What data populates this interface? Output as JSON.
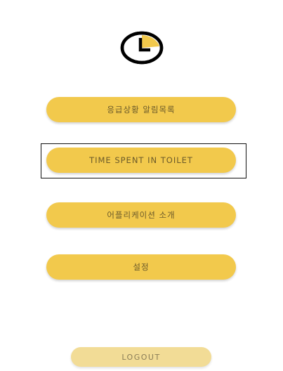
{
  "app": {
    "logo_icon": "clock-icon",
    "accent_color": "#f2c94c"
  },
  "menu": {
    "items": [
      {
        "label": "응급상황 알림목록"
      },
      {
        "label": "TIME SPENT IN TOILET"
      },
      {
        "label": "어플리케이션 소개"
      },
      {
        "label": "설정"
      }
    ]
  },
  "footer": {
    "logout_label": "LOGOUT"
  }
}
